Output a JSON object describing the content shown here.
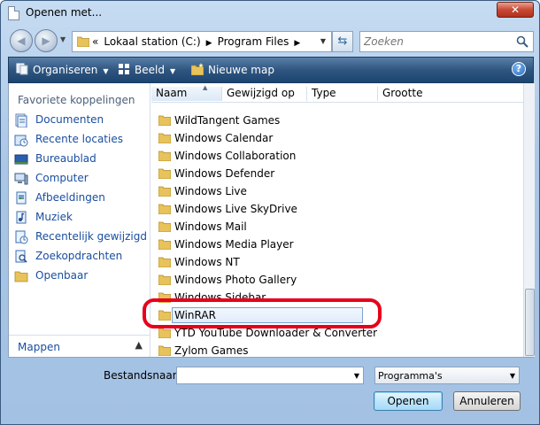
{
  "window": {
    "title": "Openen met...",
    "close_label": "✕"
  },
  "nav": {
    "breadcrumb": [
      "«",
      "Lokaal station (C:)",
      "Program Files"
    ],
    "search_placeholder": "Zoeken"
  },
  "toolbar": {
    "organize_label": "Organiseren",
    "view_label": "Beeld",
    "new_folder_label": "Nieuwe map",
    "help_label": "?"
  },
  "sidebar": {
    "heading": "Favoriete koppelingen",
    "items": [
      {
        "label": "Documenten",
        "icon": "documents-icon"
      },
      {
        "label": "Recente locaties",
        "icon": "recent-places-icon"
      },
      {
        "label": "Bureaublad",
        "icon": "desktop-icon"
      },
      {
        "label": "Computer",
        "icon": "computer-icon"
      },
      {
        "label": "Afbeeldingen",
        "icon": "pictures-icon"
      },
      {
        "label": "Muziek",
        "icon": "music-icon"
      },
      {
        "label": "Recentelijk gewijzigd",
        "icon": "recently-changed-icon"
      },
      {
        "label": "Zoekopdrachten",
        "icon": "searches-icon"
      },
      {
        "label": "Openbaar",
        "icon": "public-folder-icon"
      }
    ],
    "folders_label": "Mappen"
  },
  "columns": [
    "Naam",
    "Gewijzigd op",
    "Type",
    "Grootte"
  ],
  "files": [
    {
      "name": "WildTangent Games"
    },
    {
      "name": "Windows Calendar"
    },
    {
      "name": "Windows Collaboration"
    },
    {
      "name": "Windows Defender"
    },
    {
      "name": "Windows Live"
    },
    {
      "name": "Windows Live SkyDrive"
    },
    {
      "name": "Windows Mail"
    },
    {
      "name": "Windows Media Player"
    },
    {
      "name": "Windows NT"
    },
    {
      "name": "Windows Photo Gallery"
    },
    {
      "name": "Windows Sidebar"
    },
    {
      "name": "WinRAR",
      "selected": true
    },
    {
      "name": "YTD YouTube Downloader & Converter"
    },
    {
      "name": "Zylom Games"
    }
  ],
  "bottom": {
    "filename_label": "Bestandsnaam:",
    "filename_value": "",
    "filetype_value": "Programma's",
    "open_label": "Openen",
    "cancel_label": "Annuleren"
  },
  "colors": {
    "highlight": "#e8001a",
    "folder": "#e8c25a",
    "link": "#1a4ea0"
  }
}
